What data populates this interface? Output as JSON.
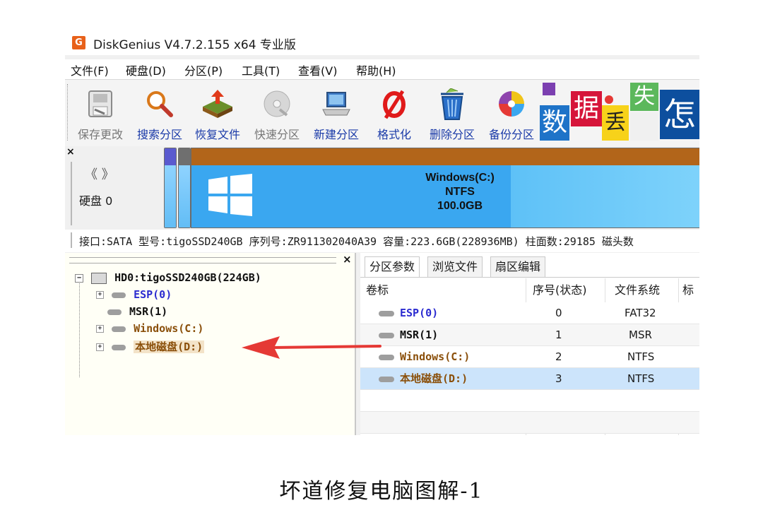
{
  "window": {
    "title": "DiskGenius V4.7.2.155 x64 专业版",
    "logo_text": "G"
  },
  "menu": [
    "文件(F)",
    "硬盘(D)",
    "分区(P)",
    "工具(T)",
    "查看(V)",
    "帮助(H)"
  ],
  "toolbar": [
    {
      "label": "保存更改",
      "icon": "save-icon",
      "disabled": true
    },
    {
      "label": "搜索分区",
      "icon": "magnifier-icon",
      "disabled": false
    },
    {
      "label": "恢复文件",
      "icon": "recover-icon",
      "disabled": false
    },
    {
      "label": "快速分区",
      "icon": "disc-icon",
      "disabled": true
    },
    {
      "label": "新建分区",
      "icon": "computer-icon",
      "disabled": false
    },
    {
      "label": "格式化",
      "icon": "format-icon",
      "disabled": false
    },
    {
      "label": "删除分区",
      "icon": "trash-icon",
      "disabled": false
    },
    {
      "label": "备份分区",
      "icon": "backup-icon",
      "disabled": false
    }
  ],
  "ad_chars": [
    "数",
    "据",
    "丢",
    "失",
    "怎"
  ],
  "diskbar": {
    "close": "×",
    "nav": "《 》",
    "disk_label": "硬盘 0",
    "main_partition": {
      "name": "Windows(C:)",
      "fs": "NTFS",
      "size": "100.0GB"
    },
    "info": "接口:SATA  型号:tigoSSD240GB  序列号:ZR911302040A39  容量:223.6GB(228936MB)  柱面数:29185  磁头数"
  },
  "tree": {
    "close": "×",
    "root": "HD0:tigoSSD240GB(224GB)",
    "items": [
      "ESP(0)",
      "MSR(1)",
      "Windows(C:)",
      "本地磁盘(D:)"
    ]
  },
  "tabs": [
    "分区参数",
    "浏览文件",
    "扇区编辑"
  ],
  "table": {
    "headers": [
      "卷标",
      "序号(状态)",
      "文件系统",
      "标识"
    ],
    "rows": [
      {
        "label": "ESP(0)",
        "index": "0",
        "fs": "FAT32"
      },
      {
        "label": "MSR(1)",
        "index": "1",
        "fs": "MSR"
      },
      {
        "label": "Windows(C:)",
        "index": "2",
        "fs": "NTFS"
      },
      {
        "label": "本地磁盘(D:)",
        "index": "3",
        "fs": "NTFS"
      }
    ]
  },
  "caption": "坏道修复电脑图解-1",
  "colors": {
    "accent_orange": "#e8611a",
    "partition_blue": "#3aa7f0",
    "partition_top_brown": "#b2651a",
    "selected_row": "#cce4fb",
    "tree_blue": "#2b2bd0",
    "tree_brown": "#8a4f0a",
    "arrow_red": "#e53935"
  }
}
